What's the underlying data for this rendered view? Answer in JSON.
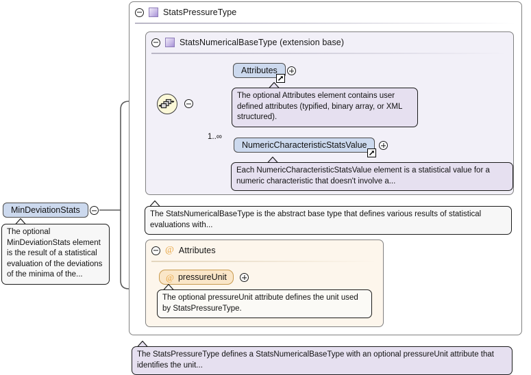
{
  "diagram": {
    "kind": "xsd-schema-documentation",
    "root_element": {
      "name": "MinDeviationStats",
      "toggle_icon": "minus-circle-icon",
      "annotation": "The optional MinDeviationStats element is the result of a statistical evaluation of the deviations of the minima of the..."
    },
    "outer_type": {
      "label": "StatsPressureType",
      "toggle_icon": "minus-circle-icon",
      "type_icon": "complex-type-icon",
      "annotation": "The StatsPressureType defines a StatsNumericalBaseType with an optional pressureUnit attribute that identifies the unit..."
    },
    "inner_type": {
      "label": "StatsNumericalBaseType (extension base)",
      "toggle_icon": "minus-circle-icon",
      "type_icon": "complex-type-icon",
      "annotation": "The StatsNumericalBaseType is the abstract base type that defines various results of statistical evaluations with...",
      "compositor": {
        "kind": "sequence-icon",
        "toggle_icon": "minus-circle-icon"
      },
      "children": [
        {
          "name": "Attributes",
          "cardinality": "",
          "expand_icon": "plus-circle-icon",
          "ref_icon": "reference-arrow-icon",
          "annotation": "The optional Attributes element contains user defined attributes (typified, binary array, or XML structured)."
        },
        {
          "name": "NumericCharacteristicStatsValue",
          "cardinality": "1..∞",
          "expand_icon": "plus-circle-icon",
          "ref_icon": "reference-arrow-icon",
          "annotation": "Each NumericCharacteristicStatsValue element is a statistical value for a numeric characteristic that doesn't involve a..."
        }
      ]
    },
    "attributes_section": {
      "label": "Attributes",
      "toggle_icon": "minus-circle-icon",
      "at_icon": "at-sign-icon",
      "items": [
        {
          "name": "pressureUnit",
          "at_icon": "at-sign-icon",
          "expand_icon": "plus-circle-icon",
          "annotation": "The optional pressureUnit attribute defines the unit used by StatsPressureType."
        }
      ]
    },
    "colors": {
      "element_fill": "#ccd9ee",
      "attribute_fill": "#fae6c8",
      "inner_type_fill": "#f2f0f8",
      "attr_section_fill": "#fdf6ec",
      "annotation_fill": "#e6e0f0",
      "annotation_alt_fill": "#f7f7f7",
      "sequence_fill": "#fbf8d8",
      "border": "#808080",
      "at_sign": "#e8a33d"
    }
  }
}
